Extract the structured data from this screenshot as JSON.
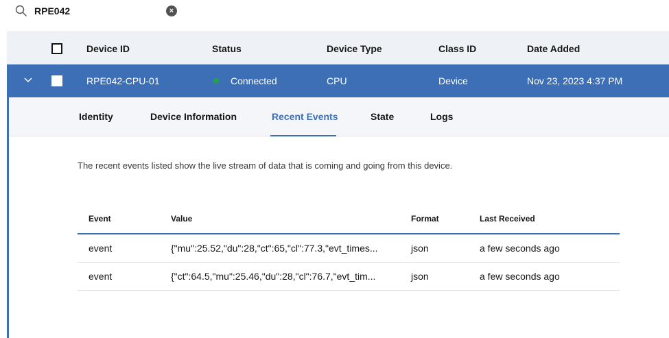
{
  "search": {
    "value": "RPE042",
    "clear_glyph": "×"
  },
  "table": {
    "columns": [
      "Device ID",
      "Status",
      "Device Type",
      "Class ID",
      "Date Added"
    ],
    "row": {
      "device_id": "RPE042-CPU-01",
      "status": "Connected",
      "device_type": "CPU",
      "class_id": "Device",
      "date_added": "Nov 23, 2023 4:37 PM",
      "status_color": "#24a148"
    }
  },
  "tabs": [
    "Identity",
    "Device Information",
    "Recent Events",
    "State",
    "Logs"
  ],
  "active_tab": "Recent Events",
  "description": "The recent events listed show the live stream of data that is coming and going from this device.",
  "events": {
    "columns": [
      "Event",
      "Value",
      "Format",
      "Last Received"
    ],
    "rows": [
      {
        "event": "event",
        "value": "{\"mu\":25.52,\"du\":28,\"ct\":65,\"cl\":77.3,\"evt_times...",
        "format": "json",
        "last_received": "a few seconds ago"
      },
      {
        "event": "event",
        "value": "{\"ct\":64.5,\"mu\":25.46,\"du\":28,\"cl\":76.7,\"evt_tim...",
        "format": "json",
        "last_received": "a few seconds ago"
      }
    ]
  },
  "colors": {
    "accent": "#3d6fb6",
    "header_bg": "#eef1f6",
    "connected": "#24a148"
  }
}
